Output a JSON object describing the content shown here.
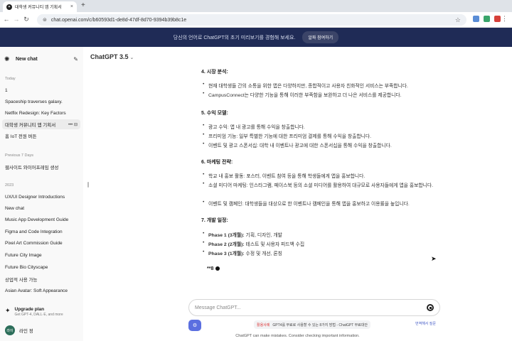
{
  "browser": {
    "tab_title": "대학생 커뮤니티 앱 기획서",
    "url": "chat.openai.com/c/b60593d1-de8d-47df-8d70-9394b39b8c1e"
  },
  "banner": {
    "text": "당신의 언어로 ChatGPT의 초기 미리보기를 경험해 보세요.",
    "button": "알파 참여하기"
  },
  "sidebar": {
    "new_chat": "New chat",
    "sections": {
      "today": "Today",
      "previous7": "Previous 7 Days",
      "y2023": "2023"
    },
    "today_items": [
      "1",
      "Spaceship traverses galaxy.",
      "Netflix Redesign: Key Factors",
      "대학생 커뮤니티 앱 기획서",
      "홈 IoT 전원 버튼"
    ],
    "prev_items": [
      "웹사이트 와이어프레임 생성"
    ],
    "y2023_items": [
      "UX/UI Designer Introductions",
      "New chat",
      "Music App Development Guide",
      "Figma and Code Integration",
      "Pixel Art Commission Guide",
      "Future City Image",
      "Future Bio Cityscape",
      "상업적 사용 가능",
      "Asian Avatar: Soft Appearance"
    ],
    "upgrade_title": "Upgrade plan",
    "upgrade_sub": "Get GPT-4, DALL·E, and more",
    "user_initials": "라이",
    "user_name": "라인 정"
  },
  "main": {
    "model": "ChatGPT 3.5",
    "s4_title": "4. 시장 분석:",
    "s4": [
      "현재 대학생들 간의 소통을 위한 앱은 다양하지만, 종합적이고 사용자 친화적인 서비스는 부족합니다.",
      "CampusConnect는 다양한 기능을 통해 이러한 부족함을 보완하고 더 나은 서비스를 제공합니다."
    ],
    "s5_title": "5. 수익 모델:",
    "s5": [
      "광고 수익: 앱 내 광고를 통해 수익을 창출합니다.",
      "프리미엄 기능: 일부 특별한 기능에 대한 프리미엄 결제를 통해 수익을 창출합니다.",
      "이벤트 및 광고 스폰서십: 대학 내 이벤트나 광고에 대한 스폰서십을 통해 수익을 창출합니다."
    ],
    "s6_title": "6. 마케팅 전략:",
    "s6": [
      "학교 내 홍보 활동: 포스터, 이벤트 참여 등을 통해 학생들에게 앱을 홍보합니다.",
      "소셜 미디어 마케팅: 인스타그램, 페이스북 등의 소셜 미디어를 활용하여 대규모로 사용자들에게 앱을 홍보합니다.",
      "이벤트 및 캠페인: 대학생들을 대상으로 한 이벤트나 캠페인을 통해 앱을 홍보하고 이용률을 높입니다."
    ],
    "s7_title": "7. 개발 일정:",
    "s7": [
      {
        "bold": "Phase 1 (3개월):",
        "rest": " 기획, 디자인, 개발"
      },
      {
        "bold": "Phase 2 (2개월):",
        "rest": " 테스트 및 사용자 피드백 수집"
      },
      {
        "bold": "Phase 3 (1개월):",
        "rest": " 수정 및 개선, 론칭"
      }
    ],
    "partial": "**8"
  },
  "composer": {
    "placeholder": "Message ChatGPT...",
    "promo_tag": "활용사례",
    "promo_text": "GPT4를 무료로 사용할 수 있는 8가지 방법 - ChatGPT 무료대안",
    "translate": "번역해서 질문",
    "disclaimer": "ChatGPT can make mistakes. Consider checking important information."
  }
}
